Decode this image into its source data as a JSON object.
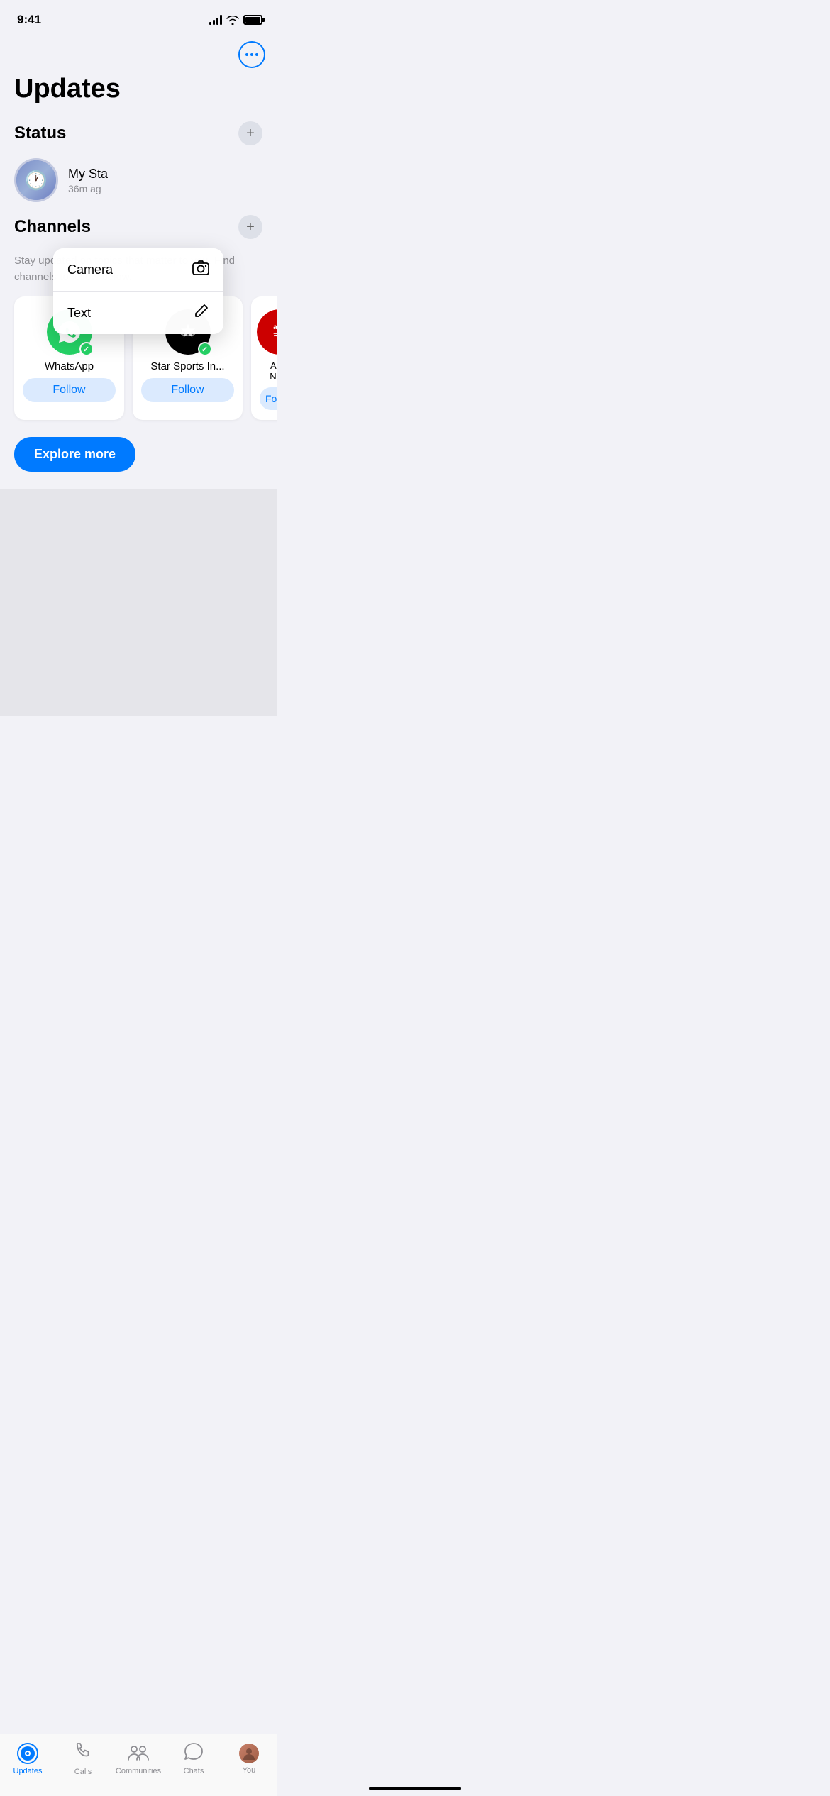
{
  "statusBar": {
    "time": "9:41"
  },
  "header": {
    "moreButton": "···"
  },
  "page": {
    "title": "Updates"
  },
  "status": {
    "sectionTitle": "Status",
    "myStatus": "My Sta",
    "timeAgo": "36m ag"
  },
  "dropdown": {
    "cameraLabel": "Camera",
    "textLabel": "Text"
  },
  "channels": {
    "sectionTitle": "Channels",
    "description": "Stay updated on topics that matter to you. Find channels to follow below.",
    "items": [
      {
        "name": "WhatsApp",
        "followLabel": "Follow"
      },
      {
        "name": "Star Sports In...",
        "followLabel": "Follow"
      },
      {
        "name": "ABP Ne...",
        "followLabel": "Follow"
      }
    ],
    "exploreMore": "Explore more"
  },
  "tabBar": {
    "items": [
      {
        "label": "Updates",
        "active": true
      },
      {
        "label": "Calls",
        "active": false
      },
      {
        "label": "Communities",
        "active": false
      },
      {
        "label": "Chats",
        "active": false
      },
      {
        "label": "You",
        "active": false
      }
    ]
  }
}
